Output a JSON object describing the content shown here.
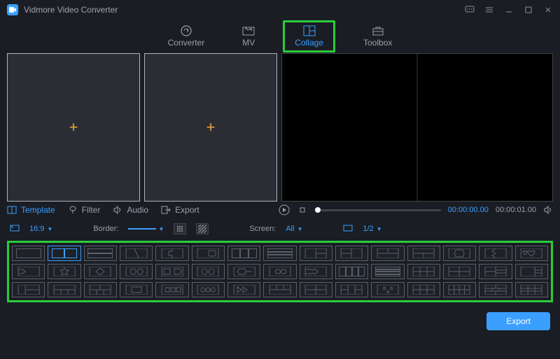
{
  "app": {
    "title": "Vidmore Video Converter"
  },
  "mainTabs": {
    "converter": "Converter",
    "mv": "MV",
    "collage": "Collage",
    "toolbox": "Toolbox"
  },
  "midTabs": {
    "template": "Template",
    "filter": "Filter",
    "audio": "Audio",
    "export": "Export"
  },
  "playback": {
    "time_current": "00:00:00.00",
    "time_total": "00:00:01.00"
  },
  "options": {
    "aspect": "16:9",
    "border_label": "Border:",
    "screen_label": "Screen:",
    "screen_value": "All",
    "page": "1/2"
  },
  "footer": {
    "export": "Export"
  }
}
